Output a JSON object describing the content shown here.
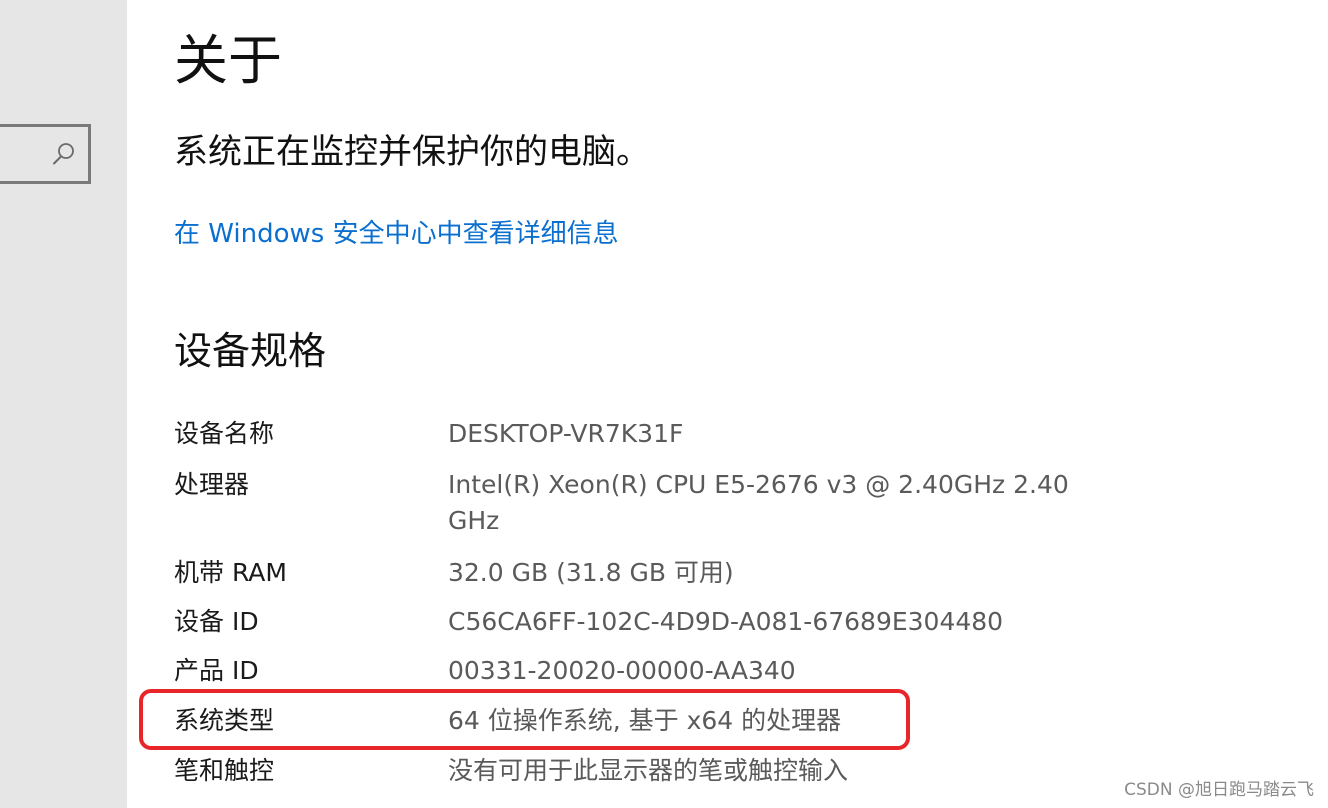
{
  "sidebar": {
    "search_icon": "search-icon"
  },
  "main": {
    "title": "关于",
    "status_text": "系统正在监控并保护你的电脑。",
    "security_link": "在 Windows 安全中心中查看详细信息",
    "section_title": "设备规格",
    "specs": [
      {
        "label": "设备名称",
        "value": "DESKTOP-VR7K31F"
      },
      {
        "label": "处理器",
        "value": "Intel(R) Xeon(R) CPU E5-2676 v3 @ 2.40GHz   2.40 GHz"
      },
      {
        "label": "机带 RAM",
        "value": "32.0 GB (31.8 GB 可用)"
      },
      {
        "label": "设备 ID",
        "value": "C56CA6FF-102C-4D9D-A081-67689E304480"
      },
      {
        "label": "产品 ID",
        "value": "00331-20020-00000-AA340"
      },
      {
        "label": "系统类型",
        "value": "64 位操作系统, 基于 x64 的处理器"
      },
      {
        "label": "笔和触控",
        "value": "没有可用于此显示器的笔或触控输入"
      }
    ]
  },
  "annotation": {
    "highlight_color": "#e8262a"
  },
  "colors": {
    "link": "#0a6fcf",
    "sidebar_bg": "#e6e6e6",
    "value_text": "#5a5a5a"
  },
  "watermark": "CSDN @旭日跑马踏云飞"
}
